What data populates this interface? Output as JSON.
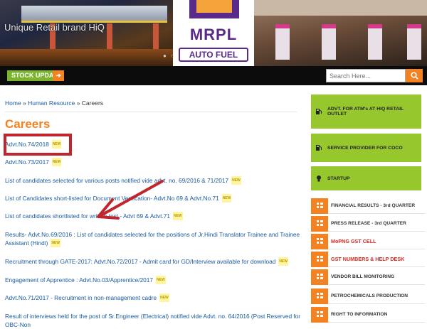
{
  "banner": {
    "tagline": "Unique Retail brand HiQ",
    "logo_text": "MRPL",
    "logo_sub": "AUTO FUEL",
    "dots": "● ○"
  },
  "navbar": {
    "stock_update": "STOCK UPDATE",
    "search_placeholder": "Search Here..."
  },
  "breadcrumb": {
    "home": "Home",
    "hr": "Human Resource",
    "current": "Careers",
    "sep": "»"
  },
  "page_title": "Careers",
  "new_badge": "NEW",
  "career_links": [
    {
      "text": "Advt.No.74/2018"
    },
    {
      "text": "Advt.No.73/2017"
    },
    {
      "text": "List of candidates selected for various posts notified vide advt. no. 69/2016 & 71/2017"
    },
    {
      "text": "List of Candidates short-listed for Document Verification- Advt.No 69 & Advt.No.71"
    },
    {
      "text": "List of candidates shortlisted for written test - Advt 69 & Advt.71"
    },
    {
      "text": "Results- Advt.No.69/2016 : List of candidates selected for the positions of Jr.Hindi Translator Trainee and Trainee Assistant (Hindi)"
    },
    {
      "text": "Recruitment through GATE-2017: Advt.No.72/2017 - Admit card for GD/Interview available for download"
    },
    {
      "text": "Engagement of Apprentice : Advt.No.03/Apprentice/2017"
    },
    {
      "text": "Advt.No.71/2017 - Recruitment in non-management cadre"
    },
    {
      "text": "Result of interviews held for the post of Sr.Engineer (Electrical) notified vide Advt. no. 64/2016 (Post Reserved for OBC-Non"
    }
  ],
  "sidebar": {
    "big_items": [
      {
        "label": "ADVT. FOR ATM's AT HIQ RETAIL OUTLET"
      },
      {
        "label": "SERVICE PROVIDER FOR COCO"
      },
      {
        "label": "STARTUP"
      }
    ],
    "small_items": [
      {
        "label": "FINANCIAL RESULTS - 3rd QUARTER"
      },
      {
        "label": "PRESS RELEASE - 3rd QUARTER"
      },
      {
        "label": "MoPNG GST CELL"
      },
      {
        "label": "GST NUMBERS & HELP DESK"
      },
      {
        "label": "VENDOR BILL MONITORING"
      },
      {
        "label": "PETROCHEMICALS PRODUCTION"
      },
      {
        "label": "RIGHT TO INFORMATION"
      }
    ]
  },
  "colors": {
    "accent_orange": "#f58220",
    "green": "#96c82e",
    "link_blue": "#1a5aa0",
    "highlight_red": "#c0262d",
    "sidebar_red_text": "#d42a22"
  }
}
